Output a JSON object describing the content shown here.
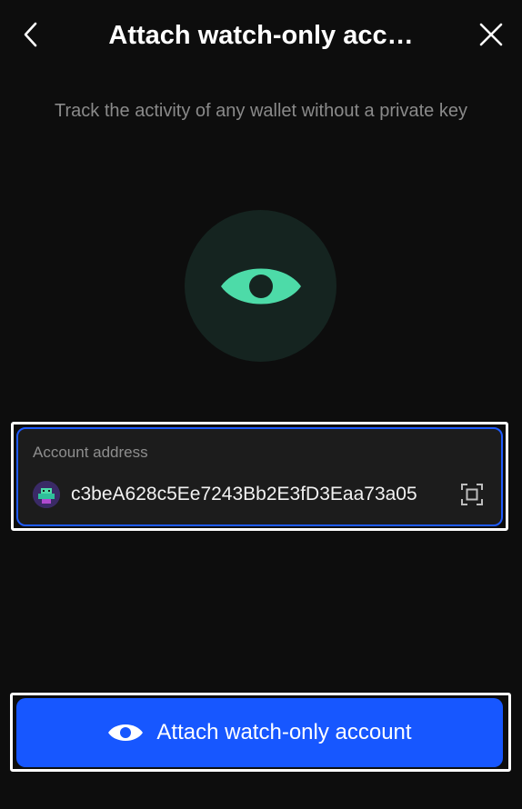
{
  "header": {
    "title": "Attach watch-only acc…",
    "back_icon": "chevron-left-icon",
    "close_icon": "close-icon"
  },
  "subtitle": "Track the activity of any wallet without a private key",
  "hero": {
    "icon": "eye-icon",
    "circle_color": "#152420",
    "icon_color": "#4ddba8"
  },
  "address_field": {
    "label": "Account address",
    "value": "c3beA628c5Ee7243Bb2E3fD3Eaa73a05",
    "avatar_icon": "account-avatar-icon",
    "scan_icon": "scan-qr-icon",
    "border_color": "#1f5bff"
  },
  "cta": {
    "label": "Attach watch-only account",
    "icon": "eye-icon",
    "color": "#1757ff"
  }
}
